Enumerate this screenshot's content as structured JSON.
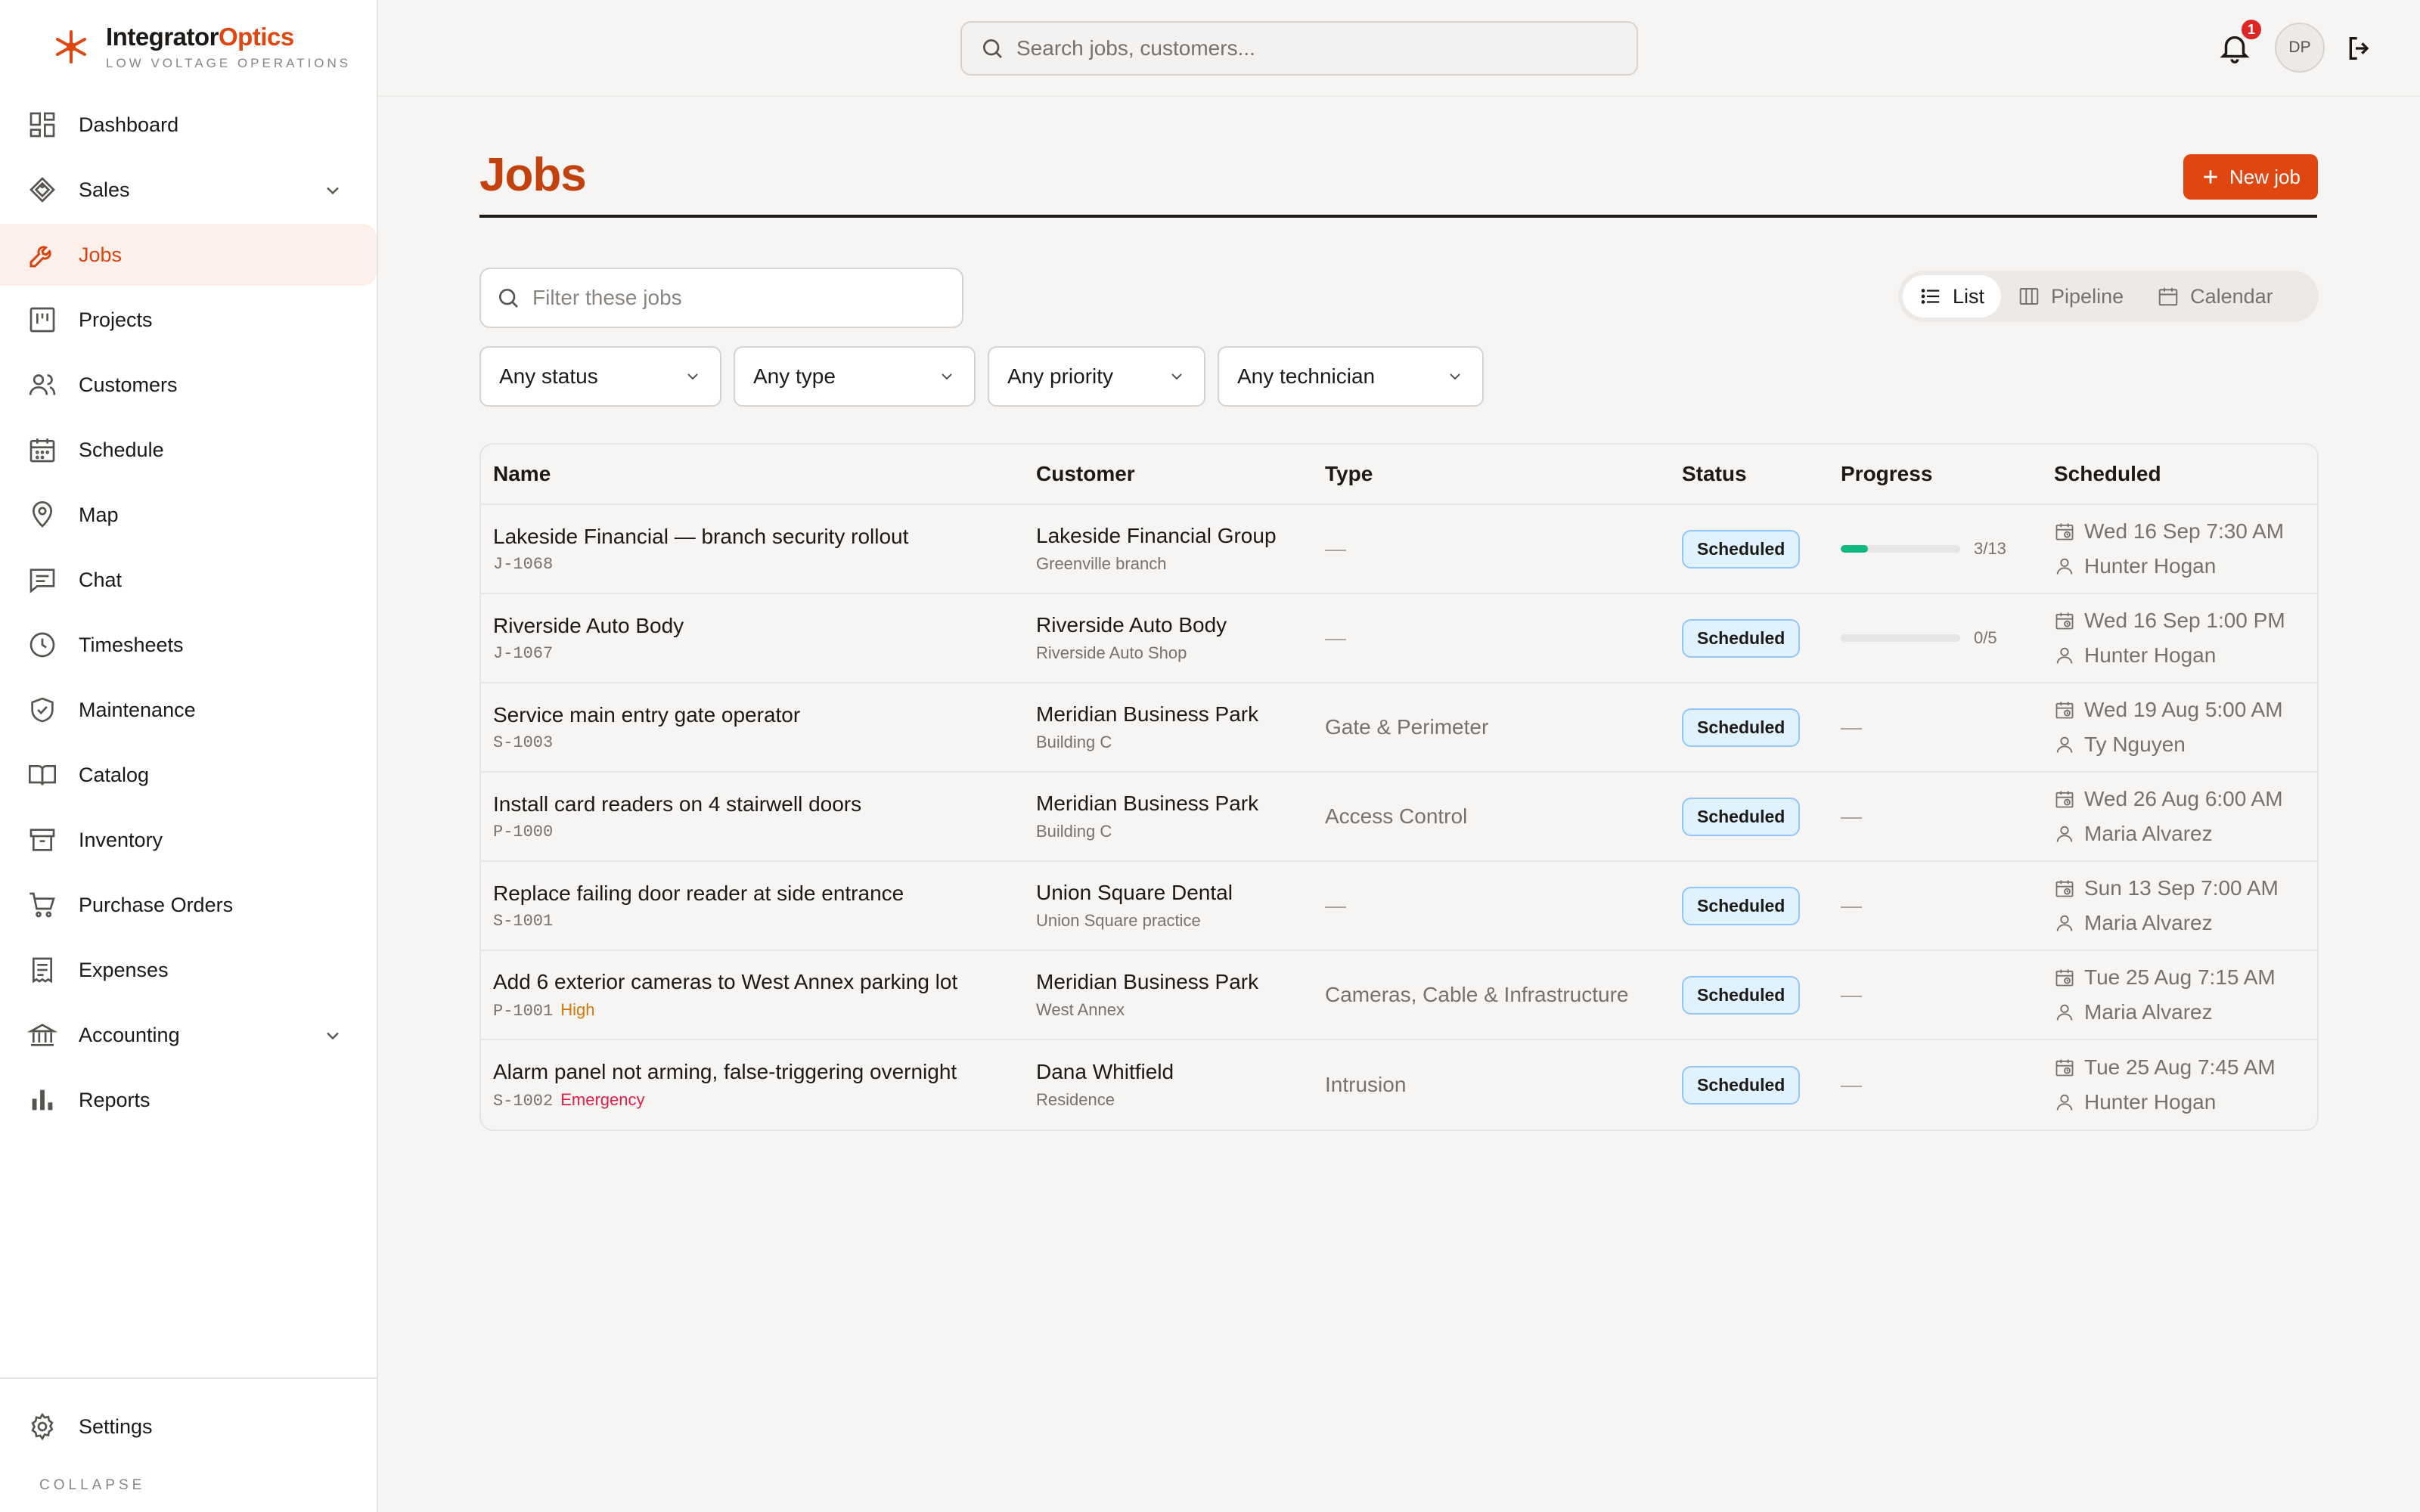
{
  "brand": {
    "name_part1": "Integrator",
    "name_part2": "Optics",
    "tagline": "LOW VOLTAGE OPERATIONS",
    "accent_color": "#e04610"
  },
  "topbar": {
    "search_placeholder": "Search jobs, customers...",
    "notification_count": "1",
    "avatar_initials": "DP"
  },
  "sidebar": {
    "items": [
      {
        "label": "Dashboard",
        "icon": "dashboard-icon"
      },
      {
        "label": "Sales",
        "icon": "tag-icon",
        "expandable": true
      },
      {
        "label": "Jobs",
        "icon": "wrench-icon",
        "active": true
      },
      {
        "label": "Projects",
        "icon": "kanban-icon"
      },
      {
        "label": "Customers",
        "icon": "users-icon"
      },
      {
        "label": "Schedule",
        "icon": "calendar-icon"
      },
      {
        "label": "Map",
        "icon": "map-pin-icon"
      },
      {
        "label": "Chat",
        "icon": "chat-icon"
      },
      {
        "label": "Timesheets",
        "icon": "clock-icon"
      },
      {
        "label": "Maintenance",
        "icon": "shield-check-icon"
      },
      {
        "label": "Catalog",
        "icon": "book-icon"
      },
      {
        "label": "Inventory",
        "icon": "archive-icon"
      },
      {
        "label": "Purchase Orders",
        "icon": "cart-icon"
      },
      {
        "label": "Expenses",
        "icon": "receipt-icon"
      },
      {
        "label": "Accounting",
        "icon": "bank-icon",
        "expandable": true
      },
      {
        "label": "Reports",
        "icon": "bar-chart-icon"
      }
    ],
    "settings_label": "Settings",
    "collapse_label": "COLLAPSE"
  },
  "page": {
    "title": "Jobs",
    "new_job_label": "New job",
    "filter_placeholder": "Filter these jobs",
    "views": [
      "List",
      "Pipeline",
      "Calendar"
    ],
    "active_view": "List",
    "selects": [
      "Any status",
      "Any type",
      "Any priority",
      "Any technician"
    ]
  },
  "table": {
    "headers": [
      "Name",
      "Customer",
      "Type",
      "Status",
      "Progress",
      "Scheduled"
    ],
    "rows": [
      {
        "name": "Lakeside Financial — branch security rollout",
        "code": "J-1068",
        "priority": "",
        "customer": "Lakeside Financial Group",
        "site": "Greenville branch",
        "type": "—",
        "status": "Scheduled",
        "progress_text": "3/13",
        "progress": 0.23,
        "date": "Wed 16 Sep 7:30 AM",
        "tech": "Hunter Hogan"
      },
      {
        "name": "Riverside Auto Body",
        "code": "J-1067",
        "priority": "",
        "customer": "Riverside Auto Body",
        "site": "Riverside Auto Shop",
        "type": "—",
        "status": "Scheduled",
        "progress_text": "0/5",
        "progress": 0,
        "date": "Wed 16 Sep 1:00 PM",
        "tech": "Hunter Hogan"
      },
      {
        "name": "Service main entry gate operator",
        "code": "S-1003",
        "priority": "",
        "customer": "Meridian Business Park",
        "site": "Building C",
        "type": "Gate & Perimeter",
        "status": "Scheduled",
        "progress_text": "",
        "progress": null,
        "date": "Wed 19 Aug 5:00 AM",
        "tech": "Ty Nguyen"
      },
      {
        "name": "Install card readers on 4 stairwell doors",
        "code": "P-1000",
        "priority": "",
        "customer": "Meridian Business Park",
        "site": "Building C",
        "type": "Access Control",
        "status": "Scheduled",
        "progress_text": "",
        "progress": null,
        "date": "Wed 26 Aug 6:00 AM",
        "tech": "Maria Alvarez"
      },
      {
        "name": "Replace failing door reader at side entrance",
        "code": "S-1001",
        "priority": "",
        "customer": "Union Square Dental",
        "site": "Union Square practice",
        "type": "—",
        "status": "Scheduled",
        "progress_text": "",
        "progress": null,
        "date": "Sun 13 Sep 7:00 AM",
        "tech": "Maria Alvarez"
      },
      {
        "name": "Add 6 exterior cameras to West Annex parking lot",
        "code": "P-1001",
        "priority": "High",
        "customer": "Meridian Business Park",
        "site": "West Annex",
        "type": "Cameras, Cable & Infrastructure",
        "status": "Scheduled",
        "progress_text": "",
        "progress": null,
        "date": "Tue 25 Aug 7:15 AM",
        "tech": "Maria Alvarez"
      },
      {
        "name": "Alarm panel not arming, false-triggering overnight",
        "code": "S-1002",
        "priority": "Emergency",
        "customer": "Dana Whitfield",
        "site": "Residence",
        "type": "Intrusion",
        "status": "Scheduled",
        "progress_text": "",
        "progress": null,
        "date": "Tue 25 Aug 7:45 AM",
        "tech": "Hunter Hogan"
      }
    ],
    "empty_marker": "—"
  }
}
